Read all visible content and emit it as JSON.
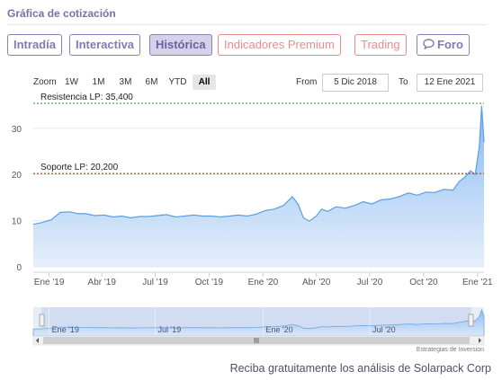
{
  "header": {
    "title": "Gráfica de cotización"
  },
  "tabs": [
    {
      "label": "Intradía",
      "style": "purple"
    },
    {
      "label": "Interactiva",
      "style": "purple"
    },
    {
      "label": "Histórica",
      "style": "active"
    },
    {
      "label": "Indicadores Premium",
      "style": "red"
    },
    {
      "label": "Trading",
      "style": "red"
    },
    {
      "label": "Foro",
      "style": "purple",
      "icon": "chat-bubble-icon"
    }
  ],
  "range_selector": {
    "zoom_label": "Zoom",
    "buttons": [
      "1W",
      "1M",
      "3M",
      "6M",
      "YTD",
      "All"
    ],
    "selected": "All",
    "from_label": "From",
    "from_value": "5 Dic 2018",
    "to_label": "To",
    "to_value": "12 Ene 2021"
  },
  "chart_data": {
    "type": "area",
    "y_ticks": [
      0,
      10,
      20,
      30
    ],
    "ylim": [
      0,
      36
    ],
    "x_ticks": [
      "Ene '19",
      "Abr '19",
      "Jul '19",
      "Oct '19",
      "Ene '20",
      "Abr '20",
      "Jul '20",
      "Oct '20",
      "Ene '21"
    ],
    "series": [
      {
        "x": [
          "2018-12-05",
          "2018-12-20",
          "2019-01-05",
          "2019-01-20",
          "2019-02-05",
          "2019-02-20",
          "2019-03-05",
          "2019-03-20",
          "2019-04-05",
          "2019-04-20",
          "2019-05-05",
          "2019-05-20",
          "2019-06-05",
          "2019-06-20",
          "2019-07-05",
          "2019-07-20",
          "2019-08-05",
          "2019-08-20",
          "2019-09-05",
          "2019-09-20",
          "2019-10-05",
          "2019-10-20",
          "2019-11-05",
          "2019-11-20",
          "2019-12-05",
          "2019-12-20",
          "2020-01-05",
          "2020-01-20",
          "2020-02-05",
          "2020-02-20",
          "2020-03-01",
          "2020-03-10",
          "2020-03-20",
          "2020-04-01",
          "2020-04-10",
          "2020-04-20",
          "2020-05-05",
          "2020-05-20",
          "2020-06-05",
          "2020-06-20",
          "2020-07-05",
          "2020-07-20",
          "2020-08-05",
          "2020-08-20",
          "2020-09-05",
          "2020-09-20",
          "2020-10-05",
          "2020-10-20",
          "2020-11-05",
          "2020-11-20",
          "2020-12-01",
          "2020-12-10",
          "2020-12-20",
          "2020-12-28",
          "2021-01-04",
          "2021-01-08",
          "2021-01-12"
        ],
        "values": [
          9.2,
          9.6,
          10.2,
          11.8,
          11.9,
          11.5,
          11.5,
          11.1,
          11.2,
          10.8,
          11.0,
          10.6,
          10.9,
          10.9,
          11.1,
          11.3,
          10.8,
          11.0,
          11.2,
          11.0,
          11.0,
          10.8,
          11.0,
          11.2,
          11.0,
          11.4,
          12.2,
          12.5,
          13.3,
          15.2,
          13.5,
          10.6,
          9.9,
          11.0,
          12.5,
          12.0,
          13.0,
          12.7,
          13.3,
          14.1,
          13.6,
          14.5,
          14.7,
          15.2,
          16.0,
          15.5,
          16.2,
          16.1,
          16.8,
          16.6,
          18.5,
          19.4,
          20.8,
          20.0,
          26.0,
          34.9,
          27.0
        ]
      }
    ],
    "annotations": [
      {
        "label": "Resistencia LP: 35,400",
        "value": 35.4,
        "color": "#3aa13a"
      },
      {
        "label": "Soporte LP: 20,200",
        "value": 20.2,
        "color": "#c2281f"
      }
    ],
    "navigator_ticks": [
      "Ene '19",
      "Jul '19",
      "Ene '20",
      "Jul '20"
    ],
    "grid": true,
    "colors": {
      "line": "#5b9de6",
      "fill_top": "#7fb4ef",
      "fill_bottom": "#e3eefb"
    }
  },
  "credits": "Estrategias de Inversion",
  "footer": {
    "text": "Reciba gratuitamente los análisis de Solarpack Corp"
  }
}
